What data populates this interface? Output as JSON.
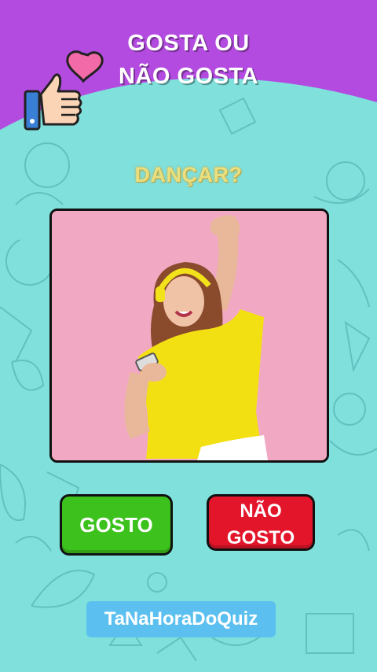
{
  "header": {
    "title_line1": "GOSTA OU",
    "title_line2": "NÃO GOSTA"
  },
  "question": "DANÇAR?",
  "photo": {
    "subject": "woman-dancing-with-headphones-icon"
  },
  "buttons": {
    "like_label": "GOSTO",
    "dislike_line1": "NÃO",
    "dislike_line2": "GOSTO"
  },
  "channel": "TaNaHoraDoQuiz",
  "colors": {
    "header": "#b44be0",
    "background": "#7fe0dc",
    "like": "#3dc21d",
    "dislike": "#e3152b",
    "channel": "#5bc0f0"
  }
}
